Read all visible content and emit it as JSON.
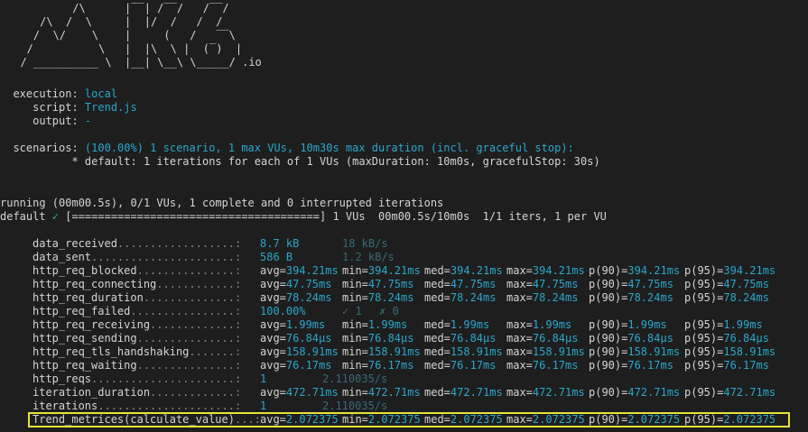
{
  "logo": {
    "art": "          /\\      |‾‾| /‾‾/   /‾‾/   \n     /\\  /  \\     |  |/  /   /  /    \n    /  \\/    \\    |     (   /   ‾‾\\  \n   /          \\   |  |\\  \\ |  (‾)  | \n  / __________ \\  |__| \\__\\ \\_____/",
    "suffix": " .io"
  },
  "execution": {
    "execution_label": "  execution: ",
    "execution_value": "local",
    "script_label": "     script: ",
    "script_value": "Trend.js",
    "output_label": "     output: ",
    "output_value": "-"
  },
  "scenarios": {
    "label": "  scenarios: ",
    "summary": "(100.00%) 1 scenario, 1 max VUs, 10m30s max duration (incl. graceful stop):",
    "detail": "           * default: 1 iterations for each of 1 VUs (maxDuration: 10m0s, gracefulStop: 30s)"
  },
  "progress": {
    "running": "running (00m00.5s), 0/1 VUs, 1 complete and 0 interrupted iterations",
    "default_label": "default ",
    "check_mark": "✓",
    "bar": " [======================================] 1 VUs  00m00.5s/10m0s  1/1 iters, 1 per VU"
  },
  "metrics": [
    {
      "name": "data_received",
      "dots": "..................:",
      "c1": "8.7 kB",
      "c1_color": "cyan",
      "c2": "18 kB/s",
      "c2_color": "dim"
    },
    {
      "name": "data_sent",
      "dots": "......................:",
      "c1": "586 B",
      "c1_color": "cyan",
      "c2": "1.2 kB/s",
      "c2_color": "dim"
    },
    {
      "name": "http_req_blocked",
      "dots": "...............:",
      "c1": "avg=394.21ms",
      "c2": "min=394.21ms",
      "c3": "med=394.21ms",
      "c4": "max=394.21ms",
      "c5": "p(90)=394.21ms",
      "c6": "p(95)=394.21ms"
    },
    {
      "name": "http_req_connecting",
      "dots": "............:",
      "c1": "avg=47.75ms",
      "c2": "min=47.75ms",
      "c3": "med=47.75ms",
      "c4": "max=47.75ms",
      "c5": "p(90)=47.75ms",
      "c6": "p(95)=47.75ms"
    },
    {
      "name": "http_req_duration",
      "dots": "..............:",
      "c1": "avg=78.24ms",
      "c2": "min=78.24ms",
      "c3": "med=78.24ms",
      "c4": "max=78.24ms",
      "c5": "p(90)=78.24ms",
      "c6": "p(95)=78.24ms"
    },
    {
      "name": "http_req_failed",
      "dots": "................:",
      "c1": "100.00%",
      "c1_color": "cyan",
      "c2": "✓ 1",
      "c2_color": "dim",
      "c3": "✗ 0",
      "c3_color": "dim",
      "c3_offset": true
    },
    {
      "name": "http_req_receiving",
      "dots": ".............:",
      "c1": "avg=1.99ms",
      "c2": "min=1.99ms",
      "c3": "med=1.99ms",
      "c4": "max=1.99ms",
      "c5": "p(90)=1.99ms",
      "c6": "p(95)=1.99ms"
    },
    {
      "name": "http_req_sending",
      "dots": "...............:",
      "c1": "avg=76.84µs",
      "c2": "min=76.84µs",
      "c3": "med=76.84µs",
      "c4": "max=76.84µs",
      "c5": "p(90)=76.84µs",
      "c6": "p(95)=76.84µs"
    },
    {
      "name": "http_req_tls_handshaking",
      "dots": ".......:",
      "c1": "avg=158.91ms",
      "c2": "min=158.91ms",
      "c3": "med=158.91ms",
      "c4": "max=158.91ms",
      "c5": "p(90)=158.91ms",
      "c6": "p(95)=158.91ms"
    },
    {
      "name": "http_req_waiting",
      "dots": "...............:",
      "c1": "avg=76.17ms",
      "c2": "min=76.17ms",
      "c3": "med=76.17ms",
      "c4": "max=76.17ms",
      "c5": "p(90)=76.17ms",
      "c6": "p(95)=76.17ms"
    },
    {
      "name": "http_reqs",
      "dots": "......................:",
      "c1": "1",
      "c1_color": "cyan",
      "c2": "2.110035/s",
      "c2_color": "dim",
      "c2_offset": true
    },
    {
      "name": "iteration_duration",
      "dots": ".............:",
      "c1": "avg=472.71ms",
      "c2": "min=472.71ms",
      "c3": "med=472.71ms",
      "c4": "max=472.71ms",
      "c5": "p(90)=472.71ms",
      "c6": "p(95)=472.71ms"
    },
    {
      "name": "iterations",
      "dots": ".....................:",
      "c1": "1",
      "c1_color": "cyan",
      "c2": "2.110035/s",
      "c2_color": "dim",
      "c2_offset": true
    },
    {
      "name": "Trend_metrices(calculate_value)",
      "dots": "...:",
      "c1": "avg=2.072375",
      "c2": "min=2.072375",
      "c3": "med=2.072375",
      "c4": "max=2.072375",
      "c5": "p(90)=2.072375",
      "c6": "p(95)=2.072375"
    }
  ],
  "colors": {
    "background": "#1e1e1e",
    "text": "#d4d4d4",
    "cyan": "#2aa7cc",
    "dim": "#3a6a78",
    "highlight_border": "#e8e23a"
  }
}
